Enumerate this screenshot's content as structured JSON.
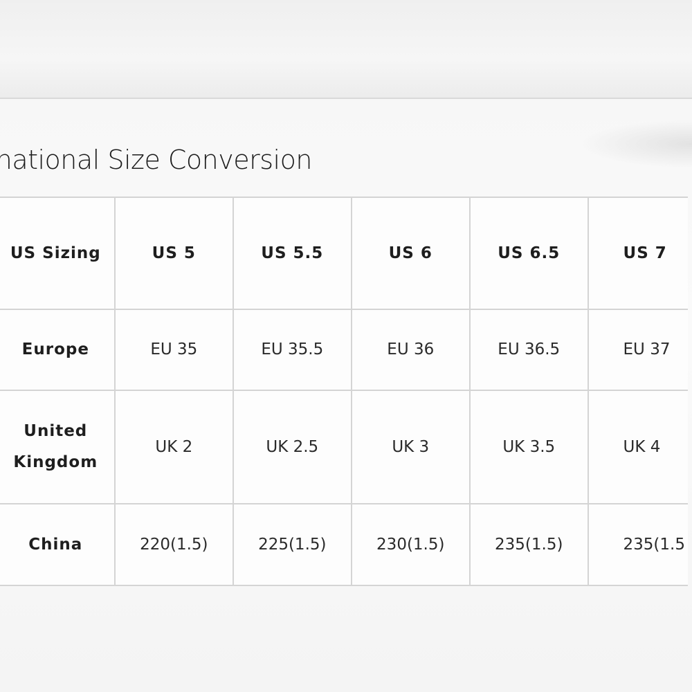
{
  "title": "ternational Size Conversion",
  "table": {
    "columns": [
      "US 5",
      "US 5.5",
      "US 6",
      "US 6.5",
      "US 7"
    ],
    "rows": [
      {
        "label": "US Sizing",
        "cells": [
          "US 5",
          "US 5.5",
          "US 6",
          "US 6.5",
          "US 7"
        ]
      },
      {
        "label": "Europe",
        "cells": [
          "EU 35",
          "EU 35.5",
          "EU 36",
          "EU 36.5",
          "EU 37"
        ]
      },
      {
        "label": "United Kingdom",
        "cells": [
          "UK 2",
          "UK 2.5",
          "UK 3",
          "UK 3.5",
          "UK 4"
        ]
      },
      {
        "label": "China",
        "cells": [
          "220(1.5)",
          "225(1.5)",
          "230(1.5)",
          "235(1.5)",
          "235(1.5"
        ]
      }
    ]
  },
  "colors": {
    "background": "#f3f3f3",
    "cell": "#fdfdfd",
    "border": "#d4d4d4",
    "text": "#2a2a2a"
  }
}
